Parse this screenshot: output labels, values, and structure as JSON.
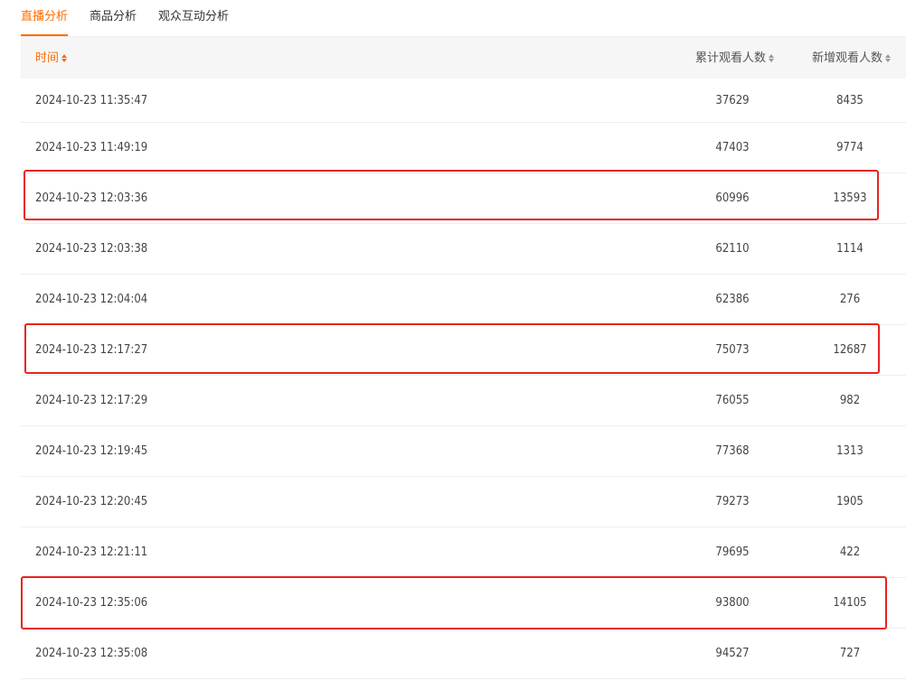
{
  "tabs": [
    {
      "label": "直播分析",
      "active": true
    },
    {
      "label": "商品分析",
      "active": false
    },
    {
      "label": "观众互动分析",
      "active": false
    }
  ],
  "table": {
    "columns": {
      "time": "时间",
      "total": "累计观看人数",
      "new": "新增观看人数"
    },
    "rows": [
      {
        "time": "2024-10-23 11:35:47",
        "total": "37629",
        "new": "8435"
      },
      {
        "time": "2024-10-23 11:49:19",
        "total": "47403",
        "new": "9774"
      },
      {
        "time": "2024-10-23 12:03:36",
        "total": "60996",
        "new": "13593"
      },
      {
        "time": "2024-10-23 12:03:38",
        "total": "62110",
        "new": "1114"
      },
      {
        "time": "2024-10-23 12:04:04",
        "total": "62386",
        "new": "276"
      },
      {
        "time": "2024-10-23 12:17:27",
        "total": "75073",
        "new": "12687"
      },
      {
        "time": "2024-10-23 12:17:29",
        "total": "76055",
        "new": "982"
      },
      {
        "time": "2024-10-23 12:19:45",
        "total": "77368",
        "new": "1313"
      },
      {
        "time": "2024-10-23 12:20:45",
        "total": "79273",
        "new": "1905"
      },
      {
        "time": "2024-10-23 12:21:11",
        "total": "79695",
        "new": "422"
      },
      {
        "time": "2024-10-23 12:35:06",
        "total": "93800",
        "new": "14105"
      },
      {
        "time": "2024-10-23 12:35:08",
        "total": "94527",
        "new": "727"
      }
    ]
  },
  "colors": {
    "accent": "#ff6a00",
    "highlight_box": "#e8231f",
    "header_bg": "#f6f6f6"
  }
}
